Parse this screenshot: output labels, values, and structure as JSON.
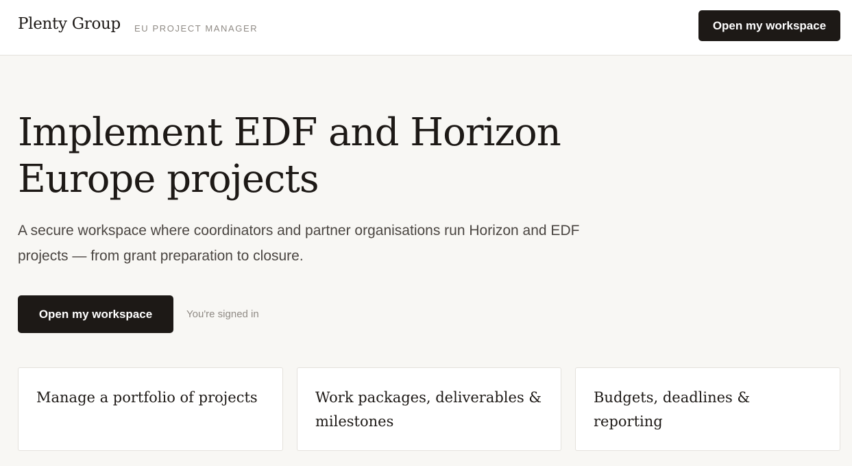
{
  "header": {
    "brand": "Plenty Group",
    "brand_sub": "EU PROJECT MANAGER",
    "cta_label": "Open my workspace"
  },
  "hero": {
    "title": "Implement EDF and Horizon Europe projects",
    "subtitle": "A secure workspace where coordinators and partner organisations run Horizon and EDF projects — from grant preparation to closure.",
    "cta_label": "Open my workspace",
    "signed_in_text": "You're signed in"
  },
  "features": [
    {
      "title": "Manage a portfolio of projects"
    },
    {
      "title": "Work packages, deliverables & milestones"
    },
    {
      "title": "Budgets, deadlines & reporting"
    }
  ],
  "colors": {
    "accent": "#1d1916",
    "background": "#f8f7f4",
    "muted_text": "#8f8a84"
  }
}
